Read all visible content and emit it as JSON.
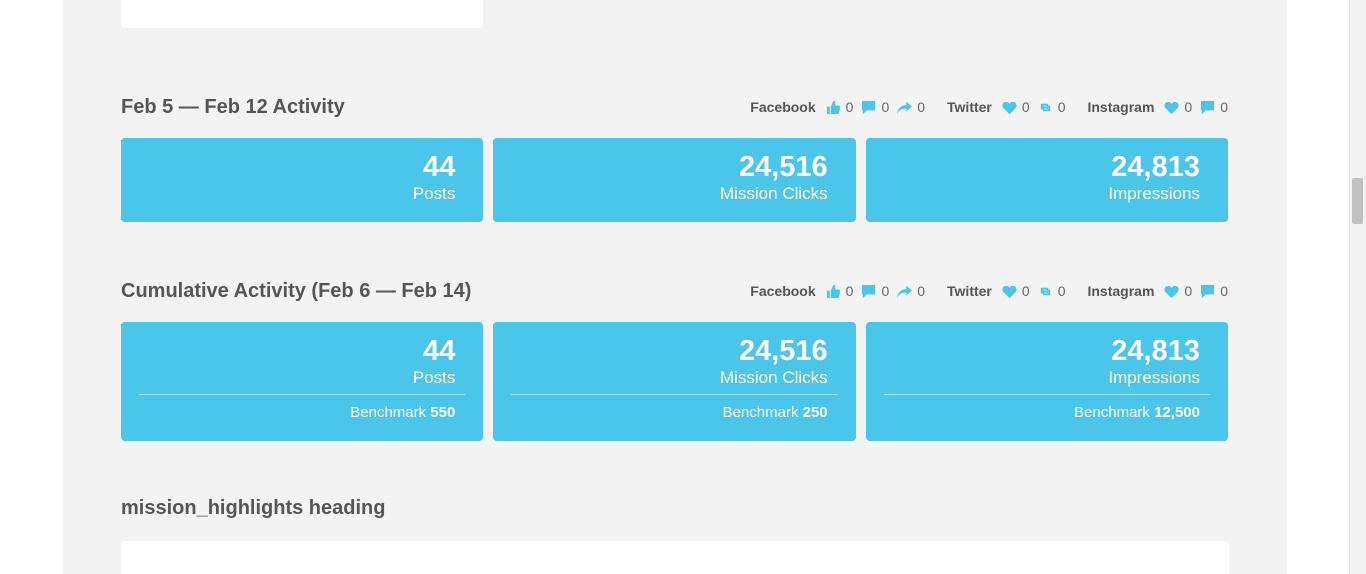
{
  "sections": [
    {
      "title": "Feb 5 — Feb 12 Activity",
      "social": {
        "facebook": {
          "name": "Facebook",
          "likes": "0",
          "comments": "0",
          "shares": "0"
        },
        "twitter": {
          "name": "Twitter",
          "likes": "0",
          "retweets": "0"
        },
        "instagram": {
          "name": "Instagram",
          "likes": "0",
          "comments": "0"
        }
      },
      "cards": [
        {
          "value": "44",
          "label": "Posts"
        },
        {
          "value": "24,516",
          "label": "Mission Clicks"
        },
        {
          "value": "24,813",
          "label": "Impressions"
        }
      ]
    },
    {
      "title": "Cumulative Activity (Feb 6 — Feb 14)",
      "social": {
        "facebook": {
          "name": "Facebook",
          "likes": "0",
          "comments": "0",
          "shares": "0"
        },
        "twitter": {
          "name": "Twitter",
          "likes": "0",
          "retweets": "0"
        },
        "instagram": {
          "name": "Instagram",
          "likes": "0",
          "comments": "0"
        }
      },
      "cards": [
        {
          "value": "44",
          "label": "Posts",
          "bench_label": "Benchmark",
          "bench_value": "550"
        },
        {
          "value": "24,516",
          "label": "Mission Clicks",
          "bench_label": "Benchmark",
          "bench_value": "250"
        },
        {
          "value": "24,813",
          "label": "Impressions",
          "bench_label": "Benchmark",
          "bench_value": "12,500"
        }
      ]
    }
  ],
  "highlights_heading": "mission_highlights heading",
  "colors": {
    "accent": "#49c6e9",
    "background": "#f3f3f3",
    "text": "#555555"
  },
  "icons": [
    "thumbs-up-icon",
    "comment-icon",
    "share-icon",
    "heart-icon",
    "retweet-icon"
  ]
}
